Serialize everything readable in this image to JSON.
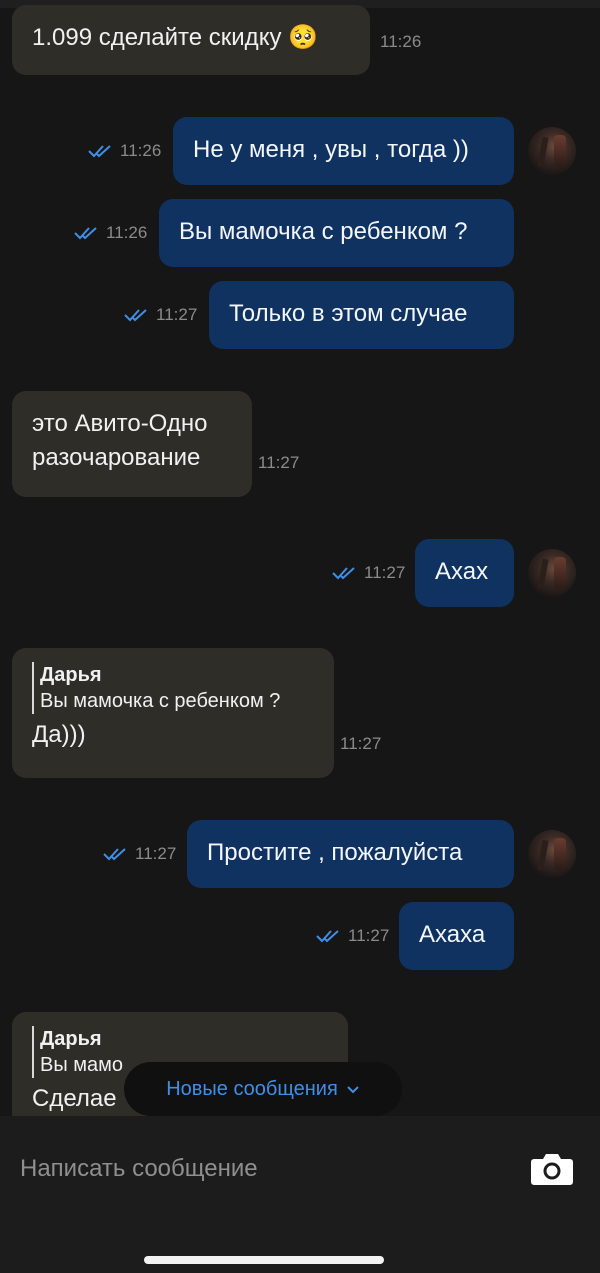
{
  "messages": [
    {
      "type": "in",
      "text": "1.099 сделайте скидку 🥺",
      "time": "11:26"
    },
    {
      "type": "out",
      "text": "Не у меня , увы , тогда ))",
      "time": "11:26",
      "avatar": true
    },
    {
      "type": "out",
      "text": "Вы мамочка с ребенком ?",
      "time": "11:26"
    },
    {
      "type": "out",
      "text": "Только в этом случае",
      "time": "11:27"
    },
    {
      "type": "in",
      "lines": [
        "это Авито-Одно",
        "разочарование"
      ],
      "time": "11:27"
    },
    {
      "type": "out",
      "text": "Ахах",
      "time": "11:27",
      "avatar": true
    },
    {
      "type": "in",
      "reply": {
        "author": "Дарья",
        "quote": "Вы мамочка с ребенком ?"
      },
      "text": "Да)))",
      "time": "11:27"
    },
    {
      "type": "out",
      "text": "Простите , пожалуйста",
      "time": "11:27",
      "avatar": true
    },
    {
      "type": "out",
      "text": "Ахаха",
      "time": "11:27"
    },
    {
      "type": "in",
      "reply": {
        "author": "Дарья",
        "quote": "Вы мамо"
      },
      "text": "Сделае"
    }
  ],
  "new_messages_label": "Новые сообщения",
  "composer": {
    "placeholder": "Написать сообщение"
  },
  "icons": {
    "read": "double-check-icon",
    "chevron": "chevron-down-icon",
    "camera": "camera-icon"
  },
  "colors": {
    "incoming": "#2f2d28",
    "outgoing": "#0f3260",
    "accent": "#3f8fe8",
    "check": "#3f8fe8"
  }
}
